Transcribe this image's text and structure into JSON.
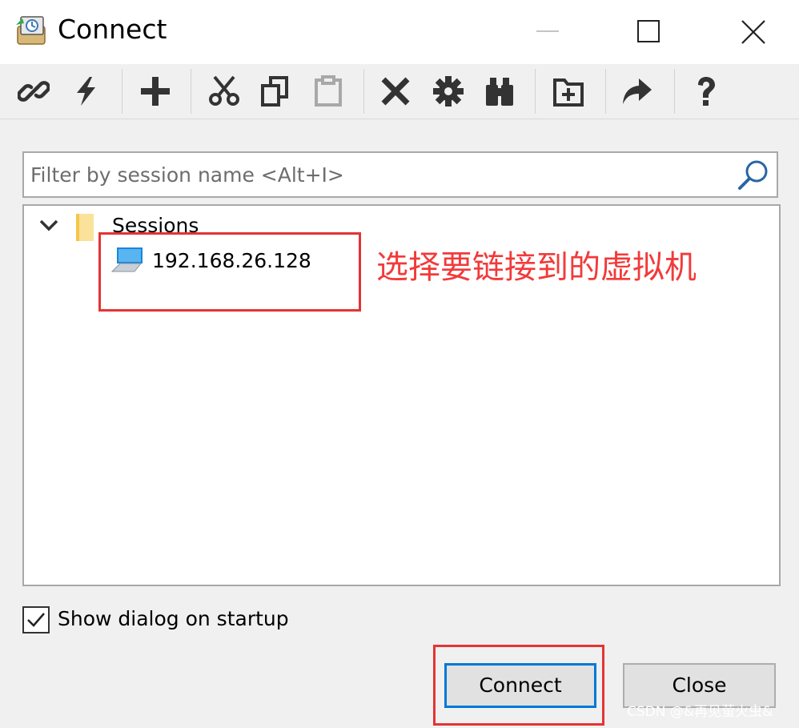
{
  "window": {
    "title": "Connect",
    "controls": {
      "minimize": "minimize-icon",
      "maximize": "maximize-icon",
      "close": "close-icon"
    }
  },
  "toolbar": {
    "icons": [
      "link-icon",
      "lightning-icon",
      "plus-icon",
      "cut-icon",
      "copy-icon",
      "paste-icon",
      "delete-icon",
      "gear-icon",
      "binoculars-icon",
      "new-folder-icon",
      "share-arrow-icon",
      "help-icon"
    ]
  },
  "filter": {
    "placeholder": "Filter by session name <Alt+I>",
    "value": ""
  },
  "tree": {
    "root_label": "Sessions",
    "root_expanded": true,
    "items": [
      {
        "label": "192.168.26.128",
        "icon": "computer-icon"
      }
    ]
  },
  "annotation": {
    "text": "选择要链接到的虚拟机",
    "color": "#e53333"
  },
  "options": {
    "show_dialog_label": "Show dialog on startup",
    "show_dialog_checked": true
  },
  "buttons": {
    "connect": "Connect",
    "close": "Close"
  },
  "watermark": "CSDN @&再见萤火虫&",
  "colors": {
    "accent": "#0078d7",
    "annotation": "#e53333",
    "panel": "#f0f0f0"
  }
}
